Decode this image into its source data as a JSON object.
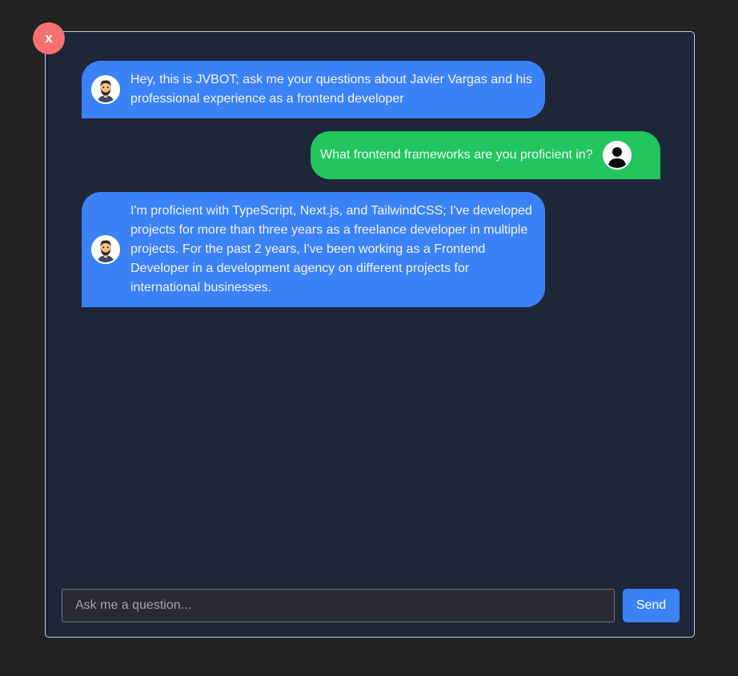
{
  "close_button": {
    "label": "x",
    "color": "#f87171"
  },
  "colors": {
    "page_background": "#232323",
    "panel_background": "#1e2738",
    "bot_bubble": "#3b82f6",
    "user_bubble": "#22c55e",
    "send_button": "#3b82f6"
  },
  "messages": [
    {
      "role": "bot",
      "avatar_icon": "bearded-man-avatar-icon",
      "text": "Hey, this is JVBOT; ask me your questions about Javier Vargas and his professional experience as a frontend developer"
    },
    {
      "role": "user",
      "avatar_icon": "user-silhouette-icon",
      "text": "What frontend frameworks are you proficient in?"
    },
    {
      "role": "bot",
      "avatar_icon": "bearded-man-avatar-icon",
      "text": "I'm proficient with TypeScript, Next.js, and TailwindCSS; I've developed projects for more than three years as a freelance developer in multiple projects. For the past 2 years, I've been working as a Frontend Developer in a development agency on different projects for international businesses."
    }
  ],
  "input": {
    "placeholder": "Ask me a question...",
    "value": ""
  },
  "send_button": {
    "label": "Send"
  }
}
